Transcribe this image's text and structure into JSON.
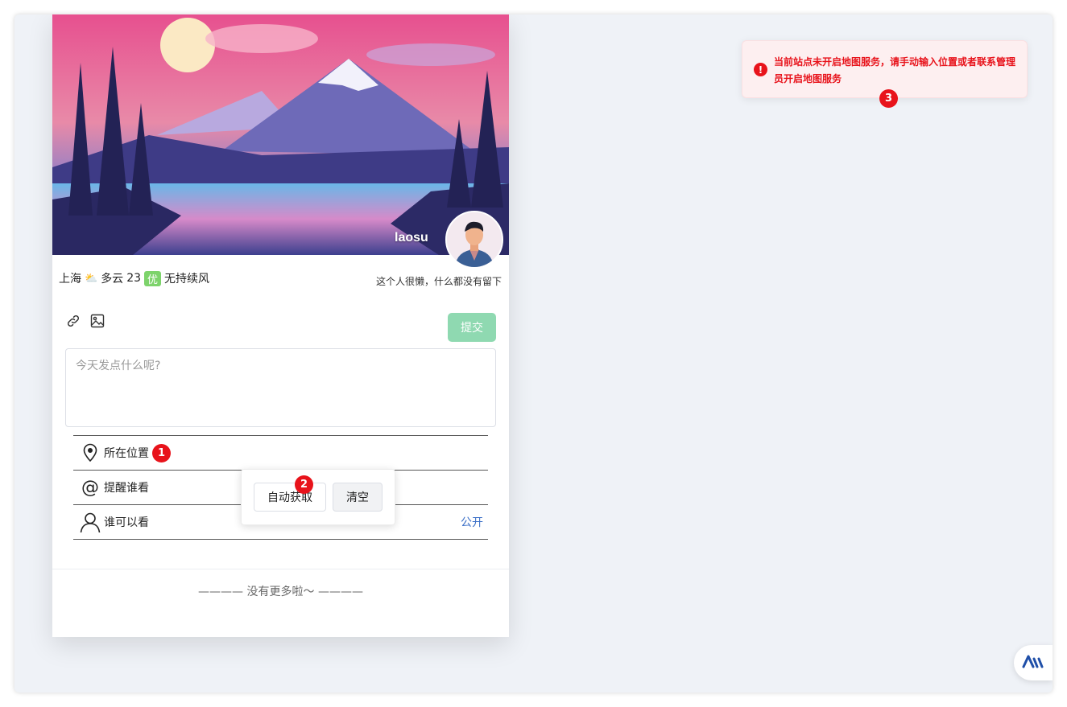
{
  "profile": {
    "username": "laosu",
    "signature": "这个人很懒，什么都没有留下"
  },
  "weather": {
    "city": "上海",
    "icon": "partly-cloudy-icon",
    "condition": "多云",
    "temperature": "23",
    "aqi_label": "优",
    "wind": "无持续风"
  },
  "composer": {
    "placeholder": "今天发点什么呢?",
    "submit_label": "提交",
    "tools": [
      "link-icon",
      "image-icon"
    ]
  },
  "options": {
    "location_label": "所在位置",
    "mention_label": "提醒谁看",
    "visibility_label": "谁可以看",
    "visibility_value": "公开"
  },
  "location_popover": {
    "auto_label": "自动获取",
    "clear_label": "清空"
  },
  "footer": {
    "no_more": "———— 没有更多啦～ ————"
  },
  "toast": {
    "message": "当前站点未开启地图服务，请手动输入位置或者联系管理员开启地图服务",
    "color": "#e8131b"
  },
  "annotations": {
    "badge1": "1",
    "badge2": "2",
    "badge3": "3"
  },
  "colors": {
    "submit": "#8fd9b1",
    "public_link": "#3b6fc7",
    "aqi": "#7dd36b"
  }
}
